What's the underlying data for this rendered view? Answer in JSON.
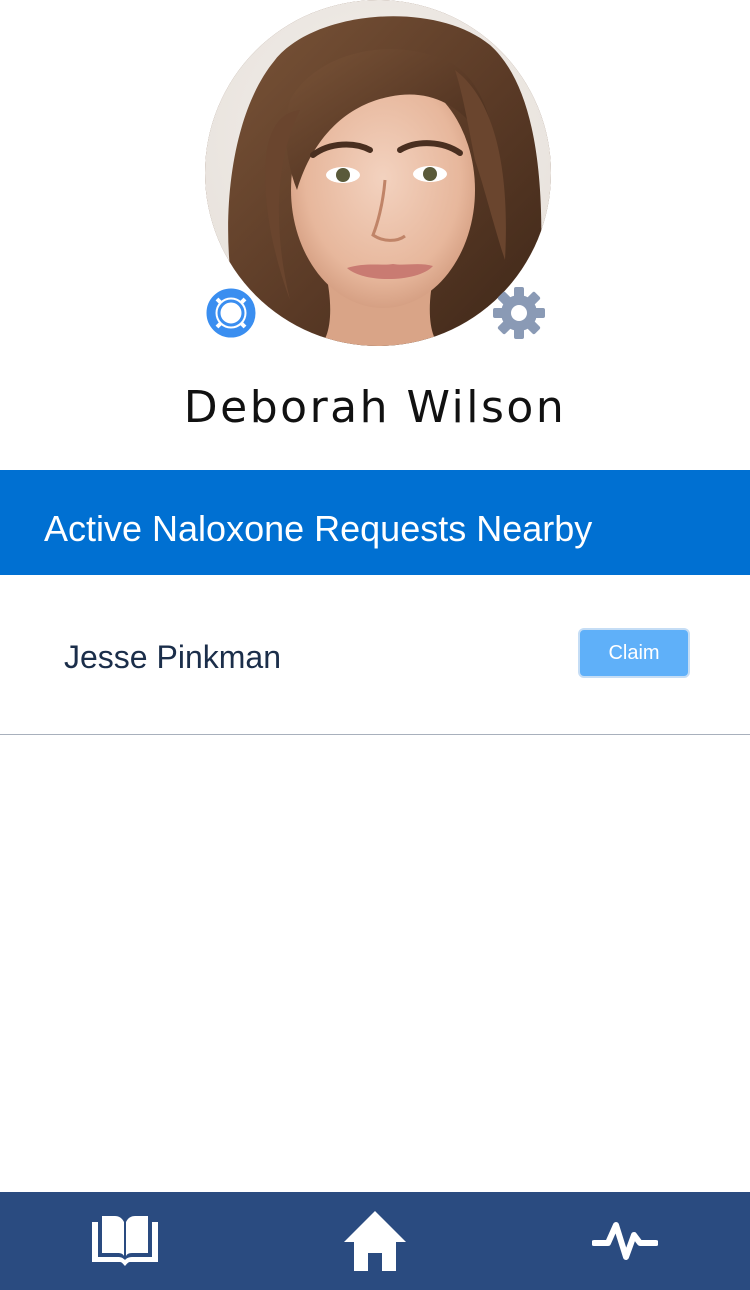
{
  "profile": {
    "name": "Deborah Wilson",
    "avatar_alt": "Profile photo",
    "help_icon": "lifebuoy-icon",
    "settings_icon": "gear-icon"
  },
  "requests": {
    "title": "Active Naloxone Requests Nearby",
    "items": [
      {
        "name": "Jesse Pinkman",
        "action_label": "Claim"
      }
    ]
  },
  "tab_bar": {
    "tabs": [
      {
        "icon": "book-icon"
      },
      {
        "icon": "home-icon"
      },
      {
        "icon": "pulse-icon"
      }
    ]
  },
  "colors": {
    "header_blue": "#0070d2",
    "tab_bar_navy": "#2a4b80",
    "claim_button": "#5fb0f9",
    "lifebuoy_blue": "#3a8ef0",
    "gear_gray": "#8a9ab5"
  }
}
